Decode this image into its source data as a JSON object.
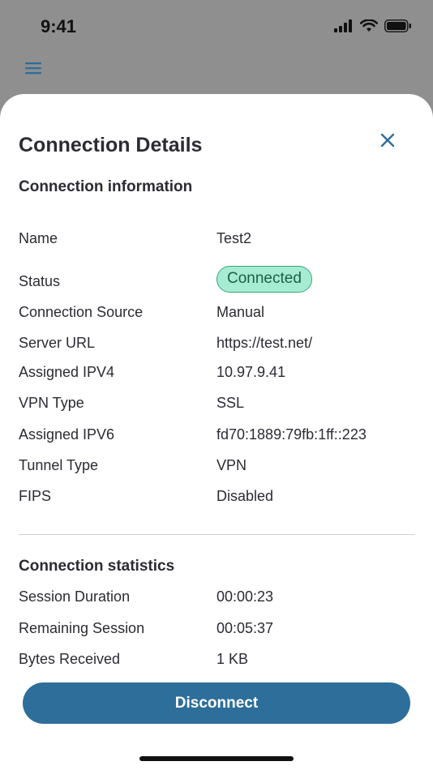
{
  "status_bar": {
    "time": "9:41"
  },
  "sheet": {
    "title": "Connection Details",
    "info_section": {
      "title": "Connection information",
      "rows": [
        {
          "label": "Name",
          "value": "Test2"
        },
        {
          "label": "Status",
          "value": "Connected"
        },
        {
          "label": "Connection Source",
          "value": "Manual"
        },
        {
          "label": "Server URL",
          "value": "https://test.net/"
        },
        {
          "label": "Assigned IPV4",
          "value": "10.97.9.41"
        },
        {
          "label": "VPN Type",
          "value": "SSL"
        },
        {
          "label": "Assigned IPV6",
          "value": "fd70:1889:79fb:1ff::223"
        },
        {
          "label": "Tunnel Type",
          "value": "VPN"
        },
        {
          "label": "FIPS",
          "value": "Disabled"
        }
      ]
    },
    "stats_section": {
      "title": "Connection statistics",
      "rows": [
        {
          "label": "Session Duration",
          "value": "00:00:23"
        },
        {
          "label": "Remaining Session",
          "value": "00:05:37"
        },
        {
          "label": "Bytes Received",
          "value": "1 KB"
        }
      ]
    },
    "disconnect_label": "Disconnect"
  },
  "colors": {
    "accent": "#2e6e9a",
    "status_connected_bg": "#a6ecd2",
    "status_connected_border": "#35a57a"
  }
}
